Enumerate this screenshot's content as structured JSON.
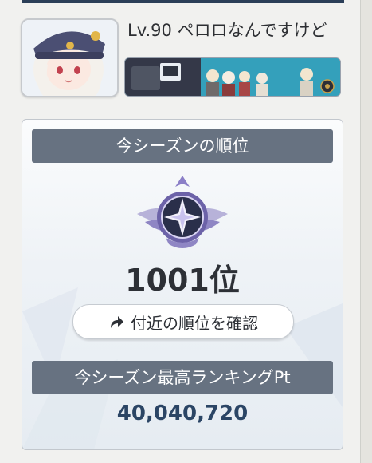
{
  "profile": {
    "name": "Lv.90 ペロロなんですけど",
    "avatar": "character-avatar",
    "banner": "character-banner"
  },
  "ranking": {
    "header": "今シーズンの順位",
    "emblem": "rank-emblem-icon",
    "rank": "1001位",
    "nearby_button_label": "付近の順位を確認",
    "best_header": "今シーズン最高ランキングPt",
    "best_points": "40,040,720"
  },
  "colors": {
    "header_bg": "#677281",
    "points_text": "#2b4565",
    "top_rule": "#2b3f58"
  }
}
